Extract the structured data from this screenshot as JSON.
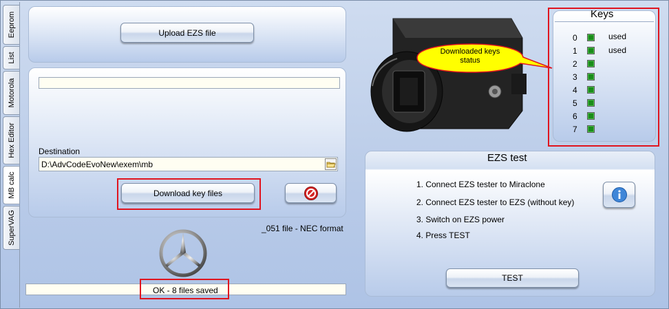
{
  "tabs": [
    {
      "label": "Eeprom"
    },
    {
      "label": "List"
    },
    {
      "label": "Motorola"
    },
    {
      "label": "Hex Editor"
    },
    {
      "label": "MB calc"
    },
    {
      "label": "SuperVAG"
    }
  ],
  "upload": {
    "button_label": "Upload EZS file"
  },
  "download": {
    "destination_label": "Destination",
    "destination_value": "D:\\AdvCodeEvoNew\\exem\\mb",
    "download_button_label": "Download key files",
    "info_text": "_051 file - NEC format",
    "status_text": "OK - 8 files saved"
  },
  "tooltip": {
    "text": "Downloaded keys status"
  },
  "keys": {
    "title": "Keys",
    "items": [
      {
        "index": "0",
        "status": "used"
      },
      {
        "index": "1",
        "status": "used"
      },
      {
        "index": "2",
        "status": ""
      },
      {
        "index": "3",
        "status": ""
      },
      {
        "index": "4",
        "status": ""
      },
      {
        "index": "5",
        "status": ""
      },
      {
        "index": "6",
        "status": ""
      },
      {
        "index": "7",
        "status": ""
      }
    ],
    "led_color": "#1a8c1a"
  },
  "ezs_test": {
    "title": "EZS test",
    "steps": [
      "1. Connect EZS tester to Miraclone",
      "2. Connect EZS tester to EZS (without key)",
      "3. Switch on EZS power",
      "4. Press TEST"
    ],
    "test_button_label": "TEST"
  },
  "colors": {
    "highlight": "#e0141e",
    "tooltip_bg": "#ffff00"
  }
}
